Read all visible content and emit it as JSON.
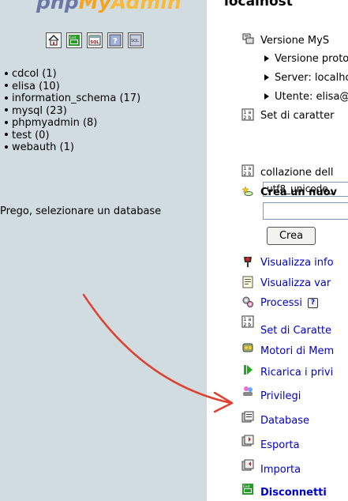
{
  "left_frame": {
    "logo": {
      "php": "php",
      "my": "My",
      "admin": "Admin"
    },
    "toolbar": [
      {
        "icon": "home-icon"
      },
      {
        "icon": "exit-icon"
      },
      {
        "icon": "sql-query-icon"
      },
      {
        "icon": "help-icon"
      },
      {
        "icon": "sql-window-icon"
      }
    ],
    "databases": [
      "cdcol (1)",
      "elisa (10)",
      "information_schema (17)",
      "mysql (23)",
      "phpmyadmin (8)",
      "test (0)",
      "webauth (1)"
    ],
    "select_message": "Prego, selezionare un database"
  },
  "right_frame": {
    "server_title": "localhost",
    "version_label": "Versione MyS",
    "sub_items": [
      "Versione proto",
      "Server: localho",
      "Utente: elisa@"
    ],
    "charset_label": "Set di caratter",
    "collation_label": "collazione dell",
    "collation_value": "utf8_unicode_",
    "create_db_label": "Crea un nuov",
    "create_button": "Crea",
    "menu": [
      {
        "label": "Visualizza info",
        "icon": "traffic-light-icon"
      },
      {
        "label": "Visualizza var",
        "icon": "document-icon"
      },
      {
        "label": "Processi",
        "icon": "gears-icon"
      },
      {
        "label": "Set di Caratte",
        "icon": "charset-icon"
      },
      {
        "label": "Motori di Mem",
        "icon": "engines-icon"
      },
      {
        "label": "Ricarica i privi",
        "icon": "reload-icon"
      },
      {
        "label": "Privilegi",
        "icon": "users-icon"
      },
      {
        "label": "Database",
        "icon": "database-icon"
      },
      {
        "label": "Esporta",
        "icon": "export-icon"
      },
      {
        "label": "Importa",
        "icon": "import-icon"
      },
      {
        "label": "Disconnetti",
        "icon": "exit-icon"
      }
    ],
    "help_mark": "?"
  },
  "colors": {
    "left_bg": "#d0dce0",
    "link": "#0000cc",
    "arrow": "#e0412f"
  }
}
